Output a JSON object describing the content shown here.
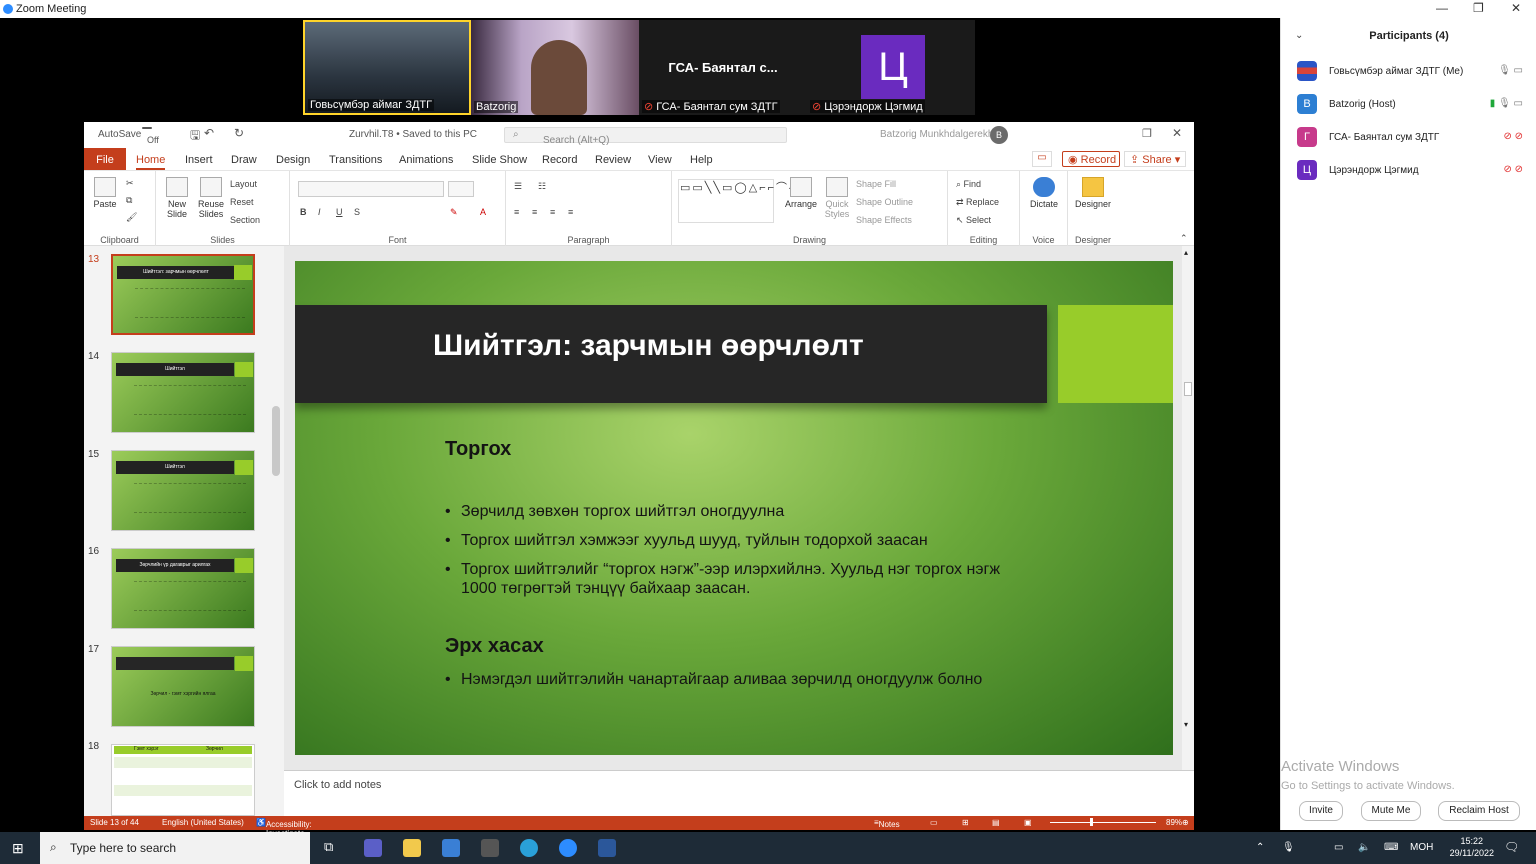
{
  "zoom": {
    "title": "Zoom Meeting"
  },
  "gallery": [
    {
      "name": "Говьсүмбэр аймаг ЗДТГ",
      "muted": false
    },
    {
      "name": "Batzorig",
      "muted": false
    },
    {
      "name": "ГСА- Баянтал сум ЗДТГ",
      "big_label": "ГСА- Баянтал с...",
      "muted": true
    },
    {
      "name": "Цэрэндорж Цэгмид",
      "avatar_letter": "Ц",
      "muted": true
    }
  ],
  "ppt": {
    "autosave": "AutoSave",
    "autosave_state": "Off",
    "filename": "Zurvhil.T8 • Saved to this PC",
    "search_placeholder": "Search (Alt+Q)",
    "user": "Batzorig Munkhdalgerekh",
    "user_initial": "B",
    "tabs": [
      "File",
      "Home",
      "Insert",
      "Draw",
      "Design",
      "Transitions",
      "Animations",
      "Slide Show",
      "Record",
      "Review",
      "View",
      "Help"
    ],
    "record_button": "Record",
    "share_button": "Share",
    "ribbon": {
      "clipboard": {
        "label": "Clipboard",
        "paste": "Paste"
      },
      "slides": {
        "label": "Slides",
        "new_slide": "New Slide",
        "reuse": "Reuse Slides",
        "layout": "Layout",
        "reset": "Reset",
        "section": "Section"
      },
      "font": {
        "label": "Font"
      },
      "paragraph": {
        "label": "Paragraph"
      },
      "drawing": {
        "label": "Drawing",
        "arrange": "Arrange",
        "quick_styles": "Quick Styles",
        "shape_fill": "Shape Fill",
        "shape_outline": "Shape Outline",
        "shape_effects": "Shape Effects"
      },
      "editing": {
        "label": "Editing",
        "find": "Find",
        "replace": "Replace",
        "select": "Select"
      },
      "voice": {
        "label": "Voice",
        "dictate": "Dictate"
      },
      "designer": {
        "label": "Designer",
        "designer": "Designer"
      }
    },
    "thumbnails": [
      {
        "num": "13",
        "title": "Шийтгэл: зарчмын өөрчлөлт"
      },
      {
        "num": "14",
        "title": "Шийтгэл"
      },
      {
        "num": "15",
        "title": "Шийтгэл"
      },
      {
        "num": "16",
        "title": "Зөрчлийн үр дагаврыг арилгах"
      },
      {
        "num": "17",
        "title": "Зөрчил - гэмт хэргийн ялгаа"
      },
      {
        "num": "18",
        "col1": "Гэмт хэрэг",
        "col2": "Зөрчил"
      }
    ],
    "slide": {
      "title": "Шийтгэл: зарчмын өөрчлөлт",
      "subtitle1": "Торгох",
      "bullets1": [
        "Зөрчилд зөвхөн торгох шийтгэл оногдуулна",
        "Торгох шийтгэл хэмжээг хуульд шууд, туйлын тодорхой заасан",
        "Торгох шийтгэлийг “торгох нэгж”-ээр илэрхийлнэ. Хуульд нэг торгох нэгж 1000 төгрөгтэй тэнцүү байхаар заасан."
      ],
      "subtitle2": "Эрх хасах",
      "bullets2": [
        "Нэмэгдэл шийтгэлийн чанартайгаар аливаа зөрчилд оногдуулж болно"
      ]
    },
    "notes_placeholder": "Click to add notes",
    "status": {
      "slide": "Slide 13 of 44",
      "language": "English (United States)",
      "accessibility": "Accessibility: Investigate",
      "notes": "Notes",
      "zoom": "89%"
    }
  },
  "participants": {
    "header": "Participants (4)",
    "list": [
      {
        "name": "Говьсүмбэр аймаг ЗДТГ (Me)",
        "letter": "",
        "color": "#d9443a",
        "muted": false
      },
      {
        "name": "Batzorig (Host)",
        "letter": "B",
        "color": "#2d7fd3",
        "muted": false
      },
      {
        "name": "ГСА- Баянтал сум ЗДТГ",
        "letter": "Г",
        "color": "#c73a8b",
        "muted": true
      },
      {
        "name": "Цэрэндорж Цэгмид",
        "letter": "Ц",
        "color": "#6a2bbf",
        "muted": true
      }
    ],
    "activate_title": "Activate Windows",
    "activate_sub": "Go to Settings to activate Windows.",
    "buttons": [
      "Invite",
      "Mute Me",
      "Reclaim Host"
    ]
  },
  "taskbar": {
    "search_placeholder": "Type here to search",
    "lang": "МОН",
    "time": "15:22",
    "date": "29/11/2022"
  }
}
